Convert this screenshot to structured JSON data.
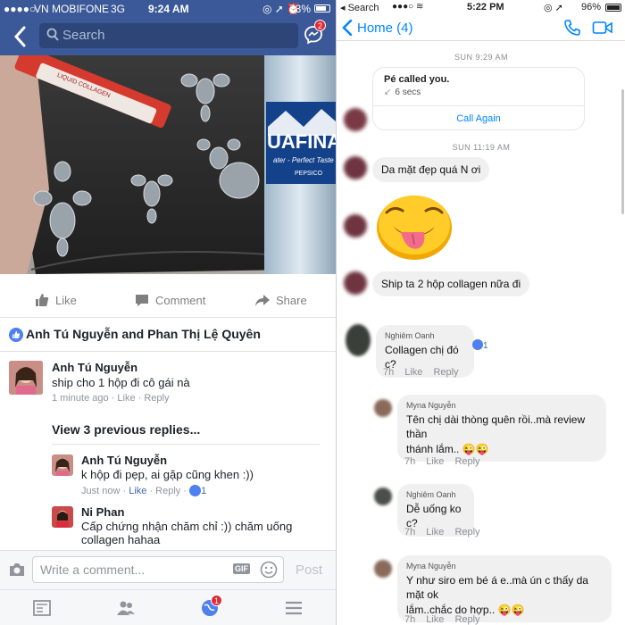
{
  "fb": {
    "status": {
      "carrier": "VN MOBIFONE",
      "network": "3G",
      "time": "9:24 AM",
      "battery": "73%"
    },
    "search_placeholder": "Search",
    "messenger_badge": "2",
    "photo_labels": {
      "box_label": "LIQUID COLLAGEN",
      "bottle_brand": "UAFINA",
      "bottle_tag": "ater - Perfect Taste",
      "bottle_maker": "PEPSICO"
    },
    "actions": {
      "like": "Like",
      "comment": "Comment",
      "share": "Share"
    },
    "likers": "Anh Tú Nguyễn and Phan Thị Lệ Quyên",
    "comments": [
      {
        "name": "Anh Tú Nguyễn",
        "text": "ship cho 1 hộp đi cô gái nà",
        "time": "1 minute ago",
        "like": "Like",
        "reply": "Reply"
      }
    ],
    "view_replies": "View 3 previous replies...",
    "replies": [
      {
        "name": "Anh Tú Nguyễn",
        "text": "k hộp đi pẹp, ai gặp cũng khen :))",
        "time": "Just now",
        "like": "Like",
        "reply": "Reply",
        "likes": "1"
      },
      {
        "name": "Ni Phan",
        "text1": "Cấp chứng nhận chăm chỉ :)) chăm uống",
        "text2": "collagen hahaa"
      }
    ],
    "composer_placeholder": "Write a comment...",
    "gif": "GIF",
    "post": "Post",
    "notif_badge": "1"
  },
  "ms": {
    "status": {
      "back_app": "Search",
      "time": "5:22 PM",
      "battery": "96%"
    },
    "back_label": "Home (4)",
    "stamp1": "SUN 9:29 AM",
    "call": {
      "title": "Pé called you.",
      "duration": "6 secs",
      "action": "Call Again"
    },
    "stamp2": "SUN 11:19 AM",
    "messages": [
      {
        "text": "Da mặt đẹp quá N ơi"
      },
      {
        "text": "Ship ta 2 hộp collagen nữa đi"
      }
    ],
    "comments": [
      {
        "name": "Nghiêm Oanh",
        "text": "Collagen chị đó c?",
        "likes": "1",
        "time": "7h",
        "like": "Like",
        "reply": "Reply"
      },
      {
        "name": "Myna Nguyễn",
        "text1": "Tên chị dài thòng quên rồi..mà review thần",
        "text2": "thánh lắm..",
        "time": "7h",
        "like": "Like",
        "reply": "Reply"
      },
      {
        "name": "Nghiêm Oanh",
        "text": "Dễ uống ko c?",
        "time": "7h",
        "like": "Like",
        "reply": "Reply"
      },
      {
        "name": "Myna Nguyễn",
        "text1": "Y như siro em bé á e..mà ún c thấy da mặt ok",
        "text2": "lắm..chắc do hợp..",
        "time": "7h",
        "like": "Like",
        "reply": "Reply"
      }
    ]
  }
}
